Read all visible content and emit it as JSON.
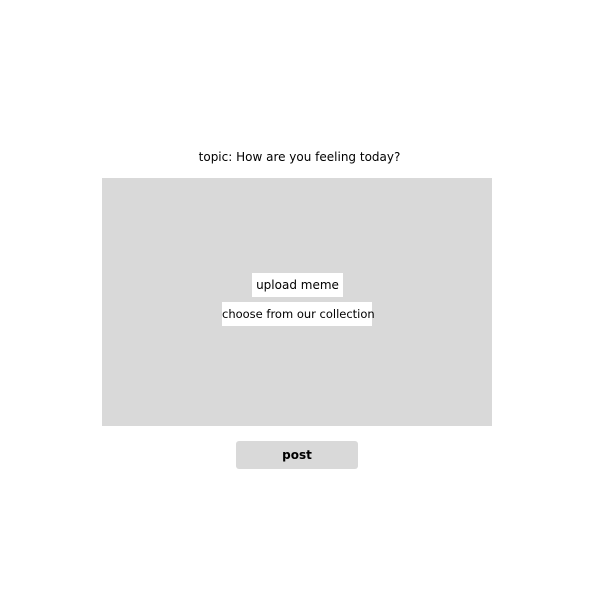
{
  "topic": {
    "text": "topic: How are you feeling today?"
  },
  "upload_area": {
    "upload_label": "upload meme",
    "collection_label": "choose from our collection"
  },
  "actions": {
    "post_label": "post"
  },
  "colors": {
    "panel_background": "#d9d9d9",
    "chip_background": "#ffffff",
    "page_background": "#ffffff"
  }
}
